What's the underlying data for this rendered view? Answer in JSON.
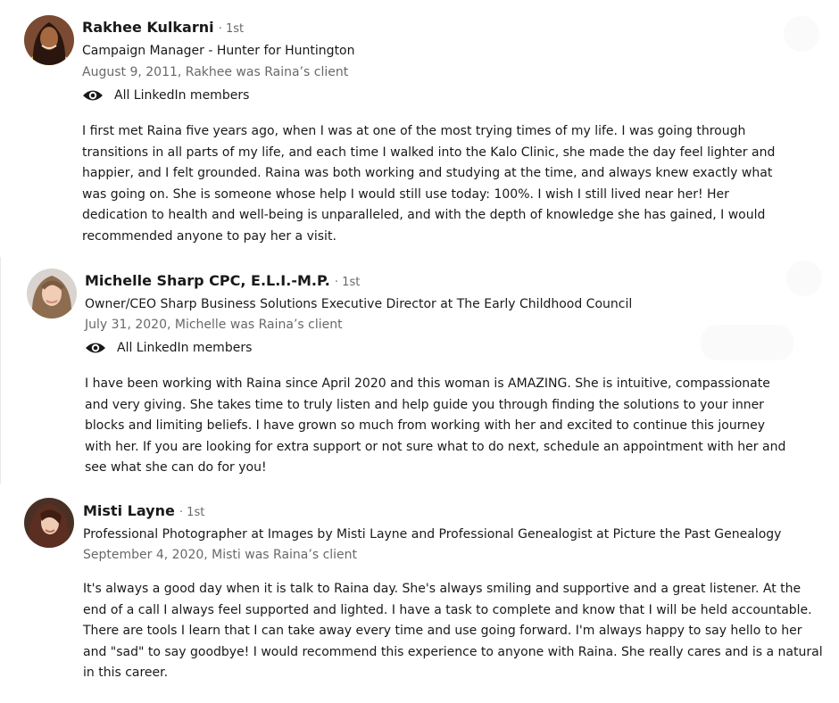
{
  "recommendations": [
    {
      "name": "Rakhee Kulkarni",
      "degree": "· 1st",
      "headline": "Campaign Manager - Hunter for Huntington",
      "date_relation": "August 9, 2011, Rakhee was Raina’s client",
      "visibility": "All LinkedIn members",
      "text": "I first met Raina five years ago, when I was at one of the most trying times of my life. I was going through transitions in all parts of my life, and each time I walked into the Kalo Clinic, she made the day feel lighter and happier, and I felt grounded. Raina was both working and studying at the time, and always knew exactly what was going on. She is someone whose help I would still use today: 100%. I wish I still lived near her! Her dedication to health and well-being is unparalleled, and with the depth of knowledge she has gained, I would recommended anyone to pay her a visit."
    },
    {
      "name": "Michelle Sharp CPC, E.L.I.-M.P.",
      "degree": "· 1st",
      "headline": "Owner/CEO Sharp Business Solutions Executive Director at The Early Childhood Council",
      "date_relation": "July 31, 2020, Michelle was Raina’s client",
      "visibility": "All LinkedIn members",
      "text": "I have been working with Raina since April 2020 and this woman is AMAZING. She is intuitive, compassionate and very giving. She takes time to truly listen and help guide you through finding the solutions to your inner blocks and limiting beliefs. I have grown so much from working with her and excited to continue this journey with her. If you are looking for extra support or not sure what to do next, schedule an appointment with her and see what she can do for you!"
    },
    {
      "name": "Misti Layne",
      "degree": "· 1st",
      "headline": "Professional Photographer at Images by Misti Layne and Professional Genealogist at Picture the Past Genealogy",
      "date_relation": "September 4, 2020, Misti was Raina’s client",
      "text": "It's always a good day when it is talk to Raina day. She's always smiling and supportive and a great listener. At the end of a call I always feel supported and lighted. I have a task to complete and know that I will be held accountable. There are tools I learn that I can take away every time and use going forward. I'm always happy to say hello to her and \"sad\" to say goodbye! I would recommend this experience to anyone with Raina. She really cares and is a natural in this career."
    }
  ],
  "icons": {
    "visibility": "eye-icon"
  },
  "colors": {
    "primary_text": "#191919",
    "secondary_text": "#666666"
  }
}
